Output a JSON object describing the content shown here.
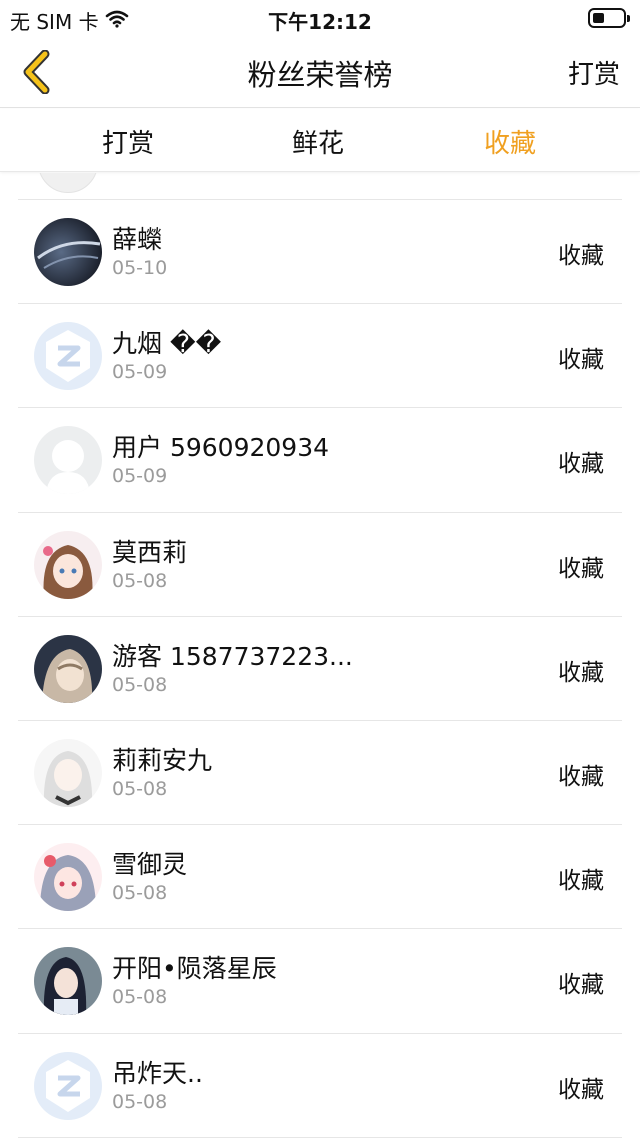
{
  "status_bar": {
    "carrier": "无 SIM 卡",
    "time": "下午12:12",
    "battery_level": 0.35
  },
  "nav": {
    "back_icon": "chevron-left-icon",
    "title": "粉丝荣誉榜",
    "right_label": "打赏",
    "accent_color": "#f0a020"
  },
  "tabs": [
    {
      "label": "打赏",
      "active": false
    },
    {
      "label": "鲜花",
      "active": false
    },
    {
      "label": "收藏",
      "active": true
    }
  ],
  "fans": [
    {
      "name": "薛蠑",
      "date": "05-10",
      "action": "收藏",
      "avatar": "dark-photo"
    },
    {
      "name": "九烟 ��",
      "date": "05-09",
      "action": "收藏",
      "avatar": "default-z"
    },
    {
      "name": "用户 5960920934",
      "date": "05-09",
      "action": "收藏",
      "avatar": "default-silhouette"
    },
    {
      "name": "莫西莉",
      "date": "05-08",
      "action": "收藏",
      "avatar": "anime-brown"
    },
    {
      "name": "游客 1587737223...",
      "date": "05-08",
      "action": "收藏",
      "avatar": "anime-dark"
    },
    {
      "name": "莉莉安九",
      "date": "05-08",
      "action": "收藏",
      "avatar": "anime-white"
    },
    {
      "name": "雪御灵",
      "date": "05-08",
      "action": "收藏",
      "avatar": "anime-pink"
    },
    {
      "name": "开阳•陨落星辰",
      "date": "05-08",
      "action": "收藏",
      "avatar": "anime-blue"
    },
    {
      "name": "吊炸天..",
      "date": "05-08",
      "action": "收藏",
      "avatar": "default-z"
    }
  ]
}
